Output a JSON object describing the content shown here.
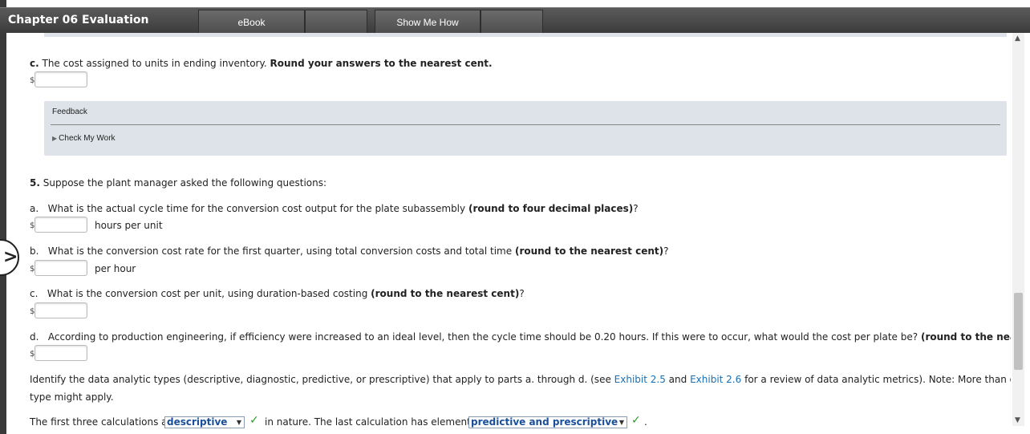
{
  "header": {
    "title": "Chapter 06 Evaluation",
    "tabs": [
      {
        "label": "eBook"
      },
      {
        "label": ""
      },
      {
        "label": "Show Me How"
      },
      {
        "label": ""
      }
    ]
  },
  "part_c_inventory": {
    "letter": "c.",
    "text": "The cost assigned to units in ending inventory.",
    "instruction": "Round your answers to the nearest cent.",
    "currency": "$",
    "value": ""
  },
  "feedback": {
    "title": "Feedback",
    "check_my_work": "Check My Work"
  },
  "question5": {
    "number": "5.",
    "text": "Suppose the plant manager asked the following questions:",
    "items": [
      {
        "letter": "a.",
        "text": "What is the actual cycle time for the conversion cost output for the plate subassembly",
        "bold": "(round to four decimal places)",
        "end": "?",
        "currency": "$",
        "unit": "hours per unit"
      },
      {
        "letter": "b.",
        "text": "What is the conversion cost rate for the first quarter, using total conversion costs and total time",
        "bold": "(round to the nearest cent)",
        "end": "?",
        "currency": "$",
        "unit": "per hour"
      },
      {
        "letter": "c.",
        "text": "What is the conversion cost per unit, using duration-based costing",
        "bold": "(round to the nearest cent)",
        "end": "?",
        "currency": "$",
        "unit": ""
      },
      {
        "letter": "d.",
        "text": "According to production engineering, if efficiency were increased to an ideal level, then the cycle time should be 0.20 hours. If this were to occur, what would the cost per plate be?",
        "bold": "(round to the nearest cent)",
        "end": "?",
        "currency": "$",
        "unit": ""
      }
    ]
  },
  "identify": {
    "line1_pre": "Identify the data analytic types (descriptive, diagnostic, predictive, or prescriptive) that apply to parts a. through d. (see",
    "link1": "Exhibit 2.5",
    "and": "and",
    "link2": "Exhibit 2.6",
    "line1_post": "for a review of data analytic metrics). Note: More than one data analytic",
    "line2": "type might apply."
  },
  "answer_line": {
    "pre": "The first three calculations are",
    "select1": "descriptive",
    "mid": "in nature. The last calculation has elements of",
    "select2": "predictive and prescriptive",
    "end": "."
  },
  "colors": {
    "header_bg": "#4a4a4a",
    "feedback_bg": "#dde3e8",
    "link": "#1a6fb3",
    "check": "#2e9c2e"
  }
}
